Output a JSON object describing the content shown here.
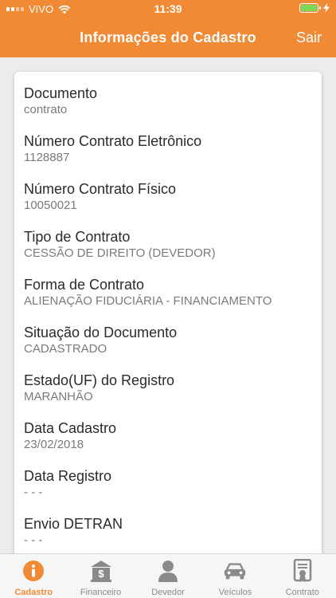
{
  "status": {
    "carrier": "VIVO",
    "time": "11:39"
  },
  "header": {
    "title": "Informações do Cadastro",
    "exit_label": "Sair"
  },
  "fields": [
    {
      "label": "Documento",
      "value": "contrato"
    },
    {
      "label": "Número Contrato Eletrônico",
      "value": "1128887"
    },
    {
      "label": "Número Contrato Físico",
      "value": "10050021"
    },
    {
      "label": "Tipo de Contrato",
      "value": "CESSÃO DE DIREITO (DEVEDOR)"
    },
    {
      "label": "Forma de Contrato",
      "value": "ALIENAÇÃO FIDUCIÁRIA - FINANCIAMENTO"
    },
    {
      "label": "Situação do Documento",
      "value": "CADASTRADO"
    },
    {
      "label": "Estado(UF) do Registro",
      "value": "MARANHÃO"
    },
    {
      "label": "Data Cadastro",
      "value": "23/02/2018"
    },
    {
      "label": "Data Registro",
      "value": "- - -"
    },
    {
      "label": "Envio DETRAN",
      "value": "- - -"
    }
  ],
  "tabs": [
    {
      "label": "Cadastro",
      "icon": "info-icon"
    },
    {
      "label": "Financeiro",
      "icon": "bank-icon"
    },
    {
      "label": "Devedor",
      "icon": "person-icon"
    },
    {
      "label": "Veículos",
      "icon": "car-icon"
    },
    {
      "label": "Contrato",
      "icon": "certificate-icon"
    }
  ],
  "colors": {
    "accent": "#f08a34",
    "inactive": "#8a8a8a"
  }
}
